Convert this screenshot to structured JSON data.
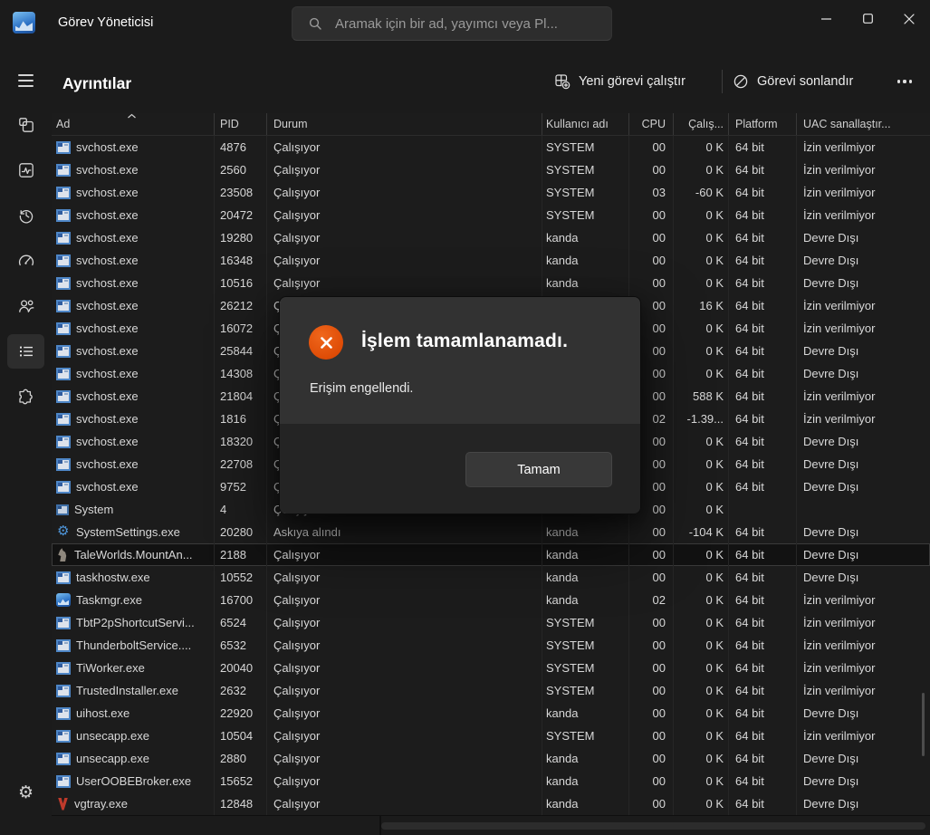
{
  "titlebar": {
    "app_title": "Görev Yöneticisi",
    "search_placeholder": "Aramak için bir ad, yayımcı veya Pl..."
  },
  "sidebar": {
    "items": [
      {
        "icon": "menu-icon",
        "selected": false
      },
      {
        "icon": "processes-icon",
        "selected": false
      },
      {
        "icon": "performance-icon",
        "selected": false
      },
      {
        "icon": "app-history-icon",
        "selected": false
      },
      {
        "icon": "startup-apps-icon",
        "selected": false
      },
      {
        "icon": "users-icon",
        "selected": false
      },
      {
        "icon": "details-icon",
        "selected": true
      },
      {
        "icon": "services-icon",
        "selected": false
      }
    ],
    "bottom_icon": "settings-gear-icon"
  },
  "header": {
    "page_title": "Ayrıntılar",
    "run_new_task_label": "Yeni görevi çalıştır",
    "run_new_task_icon": "new-task-icon",
    "end_task_label": "Görevi sonlandır",
    "end_task_icon": "block-icon",
    "more_icon": "ellipsis-icon"
  },
  "table": {
    "columns": [
      "Ad",
      "PID",
      "Durum",
      "Kullanıcı adı",
      "CPU",
      "Çalış...",
      "Platform",
      "UAC sanallaştır..."
    ],
    "sort": {
      "column": "Ad",
      "direction": "asc"
    },
    "rows": [
      {
        "icon": "exe-icon",
        "name": "svchost.exe",
        "pid": "4876",
        "status": "Çalışıyor",
        "user": "SYSTEM",
        "cpu": "00",
        "mem": "0 K",
        "platform": "64 bit",
        "uac": "İzin verilmiyor",
        "selected": false
      },
      {
        "icon": "exe-icon",
        "name": "svchost.exe",
        "pid": "2560",
        "status": "Çalışıyor",
        "user": "SYSTEM",
        "cpu": "00",
        "mem": "0 K",
        "platform": "64 bit",
        "uac": "İzin verilmiyor",
        "selected": false
      },
      {
        "icon": "exe-icon",
        "name": "svchost.exe",
        "pid": "23508",
        "status": "Çalışıyor",
        "user": "SYSTEM",
        "cpu": "03",
        "mem": "-60 K",
        "platform": "64 bit",
        "uac": "İzin verilmiyor",
        "selected": false
      },
      {
        "icon": "exe-icon",
        "name": "svchost.exe",
        "pid": "20472",
        "status": "Çalışıyor",
        "user": "SYSTEM",
        "cpu": "00",
        "mem": "0 K",
        "platform": "64 bit",
        "uac": "İzin verilmiyor",
        "selected": false
      },
      {
        "icon": "exe-icon",
        "name": "svchost.exe",
        "pid": "19280",
        "status": "Çalışıyor",
        "user": "kanda",
        "cpu": "00",
        "mem": "0 K",
        "platform": "64 bit",
        "uac": "Devre Dışı",
        "selected": false
      },
      {
        "icon": "exe-icon",
        "name": "svchost.exe",
        "pid": "16348",
        "status": "Çalışıyor",
        "user": "kanda",
        "cpu": "00",
        "mem": "0 K",
        "platform": "64 bit",
        "uac": "Devre Dışı",
        "selected": false
      },
      {
        "icon": "exe-icon",
        "name": "svchost.exe",
        "pid": "10516",
        "status": "Çalışıyor",
        "user": "kanda",
        "cpu": "00",
        "mem": "0 K",
        "platform": "64 bit",
        "uac": "Devre Dışı",
        "selected": false
      },
      {
        "icon": "exe-icon",
        "name": "svchost.exe",
        "pid": "26212",
        "status": "Çalışıyor",
        "user": "",
        "cpu": "00",
        "mem": "16 K",
        "platform": "64 bit",
        "uac": "İzin verilmiyor",
        "selected": false
      },
      {
        "icon": "exe-icon",
        "name": "svchost.exe",
        "pid": "16072",
        "status": "Çalışıyor",
        "user": "",
        "cpu": "00",
        "mem": "0 K",
        "platform": "64 bit",
        "uac": "İzin verilmiyor",
        "selected": false
      },
      {
        "icon": "exe-icon",
        "name": "svchost.exe",
        "pid": "25844",
        "status": "Çalışıyor",
        "user": "",
        "cpu": "00",
        "mem": "0 K",
        "platform": "64 bit",
        "uac": "Devre Dışı",
        "selected": false
      },
      {
        "icon": "exe-icon",
        "name": "svchost.exe",
        "pid": "14308",
        "status": "Çalışıyor",
        "user": "",
        "cpu": "00",
        "mem": "0 K",
        "platform": "64 bit",
        "uac": "Devre Dışı",
        "selected": false
      },
      {
        "icon": "exe-icon",
        "name": "svchost.exe",
        "pid": "21804",
        "status": "Çalışıyor",
        "user": "",
        "cpu": "00",
        "mem": "588 K",
        "platform": "64 bit",
        "uac": "İzin verilmiyor",
        "selected": false
      },
      {
        "icon": "exe-icon",
        "name": "svchost.exe",
        "pid": "1816",
        "status": "Çalışıyor",
        "user": "",
        "cpu": "02",
        "mem": "-1.39...",
        "platform": "64 bit",
        "uac": "İzin verilmiyor",
        "selected": false
      },
      {
        "icon": "exe-icon",
        "name": "svchost.exe",
        "pid": "18320",
        "status": "Çalışıyor",
        "user": "",
        "cpu": "00",
        "mem": "0 K",
        "platform": "64 bit",
        "uac": "Devre Dışı",
        "selected": false
      },
      {
        "icon": "exe-icon",
        "name": "svchost.exe",
        "pid": "22708",
        "status": "Çalışıyor",
        "user": "",
        "cpu": "00",
        "mem": "0 K",
        "platform": "64 bit",
        "uac": "Devre Dışı",
        "selected": false
      },
      {
        "icon": "exe-icon",
        "name": "svchost.exe",
        "pid": "9752",
        "status": "Çalışıyor",
        "user": "",
        "cpu": "00",
        "mem": "0 K",
        "platform": "64 bit",
        "uac": "Devre Dışı",
        "selected": false
      },
      {
        "icon": "system-icon",
        "name": "System",
        "pid": "4",
        "status": "Çalışıyor",
        "user": "",
        "cpu": "00",
        "mem": "0 K",
        "platform": "",
        "uac": "",
        "selected": false
      },
      {
        "icon": "settings-gear-icon",
        "name": "SystemSettings.exe",
        "pid": "20280",
        "status": "Askıya alındı",
        "user": "kanda",
        "cpu": "00",
        "mem": "-104 K",
        "platform": "64 bit",
        "uac": "Devre Dışı",
        "selected": false
      },
      {
        "icon": "horse-icon",
        "name": "TaleWorlds.MountAn...",
        "pid": "2188",
        "status": "Çalışıyor",
        "user": "kanda",
        "cpu": "00",
        "mem": "0 K",
        "platform": "64 bit",
        "uac": "Devre Dışı",
        "selected": true
      },
      {
        "icon": "exe-icon",
        "name": "taskhostw.exe",
        "pid": "10552",
        "status": "Çalışıyor",
        "user": "kanda",
        "cpu": "00",
        "mem": "0 K",
        "platform": "64 bit",
        "uac": "Devre Dışı",
        "selected": false
      },
      {
        "icon": "taskmgr-icon",
        "name": "Taskmgr.exe",
        "pid": "16700",
        "status": "Çalışıyor",
        "user": "kanda",
        "cpu": "02",
        "mem": "0 K",
        "platform": "64 bit",
        "uac": "İzin verilmiyor",
        "selected": false
      },
      {
        "icon": "exe-icon",
        "name": "TbtP2pShortcutServi...",
        "pid": "6524",
        "status": "Çalışıyor",
        "user": "SYSTEM",
        "cpu": "00",
        "mem": "0 K",
        "platform": "64 bit",
        "uac": "İzin verilmiyor",
        "selected": false
      },
      {
        "icon": "exe-icon",
        "name": "ThunderboltService....",
        "pid": "6532",
        "status": "Çalışıyor",
        "user": "SYSTEM",
        "cpu": "00",
        "mem": "0 K",
        "platform": "64 bit",
        "uac": "İzin verilmiyor",
        "selected": false
      },
      {
        "icon": "exe-icon",
        "name": "TiWorker.exe",
        "pid": "20040",
        "status": "Çalışıyor",
        "user": "SYSTEM",
        "cpu": "00",
        "mem": "0 K",
        "platform": "64 bit",
        "uac": "İzin verilmiyor",
        "selected": false
      },
      {
        "icon": "exe-icon",
        "name": "TrustedInstaller.exe",
        "pid": "2632",
        "status": "Çalışıyor",
        "user": "SYSTEM",
        "cpu": "00",
        "mem": "0 K",
        "platform": "64 bit",
        "uac": "İzin verilmiyor",
        "selected": false
      },
      {
        "icon": "exe-icon",
        "name": "uihost.exe",
        "pid": "22920",
        "status": "Çalışıyor",
        "user": "kanda",
        "cpu": "00",
        "mem": "0 K",
        "platform": "64 bit",
        "uac": "Devre Dışı",
        "selected": false
      },
      {
        "icon": "exe-icon",
        "name": "unsecapp.exe",
        "pid": "10504",
        "status": "Çalışıyor",
        "user": "SYSTEM",
        "cpu": "00",
        "mem": "0 K",
        "platform": "64 bit",
        "uac": "İzin verilmiyor",
        "selected": false
      },
      {
        "icon": "exe-icon",
        "name": "unsecapp.exe",
        "pid": "2880",
        "status": "Çalışıyor",
        "user": "kanda",
        "cpu": "00",
        "mem": "0 K",
        "platform": "64 bit",
        "uac": "Devre Dışı",
        "selected": false
      },
      {
        "icon": "exe-icon",
        "name": "UserOOBEBroker.exe",
        "pid": "15652",
        "status": "Çalışıyor",
        "user": "kanda",
        "cpu": "00",
        "mem": "0 K",
        "platform": "64 bit",
        "uac": "Devre Dışı",
        "selected": false
      },
      {
        "icon": "vanguard-icon",
        "name": "vgtray.exe",
        "pid": "12848",
        "status": "Çalışıyor",
        "user": "kanda",
        "cpu": "00",
        "mem": "0 K",
        "platform": "64 bit",
        "uac": "Devre Dışı",
        "selected": false
      }
    ]
  },
  "dialog": {
    "icon": "error-x-icon",
    "accent_color": "#E8550F",
    "title": "İşlem tamamlanamadı.",
    "message": "Erişim engellendi.",
    "ok_label": "Tamam"
  }
}
